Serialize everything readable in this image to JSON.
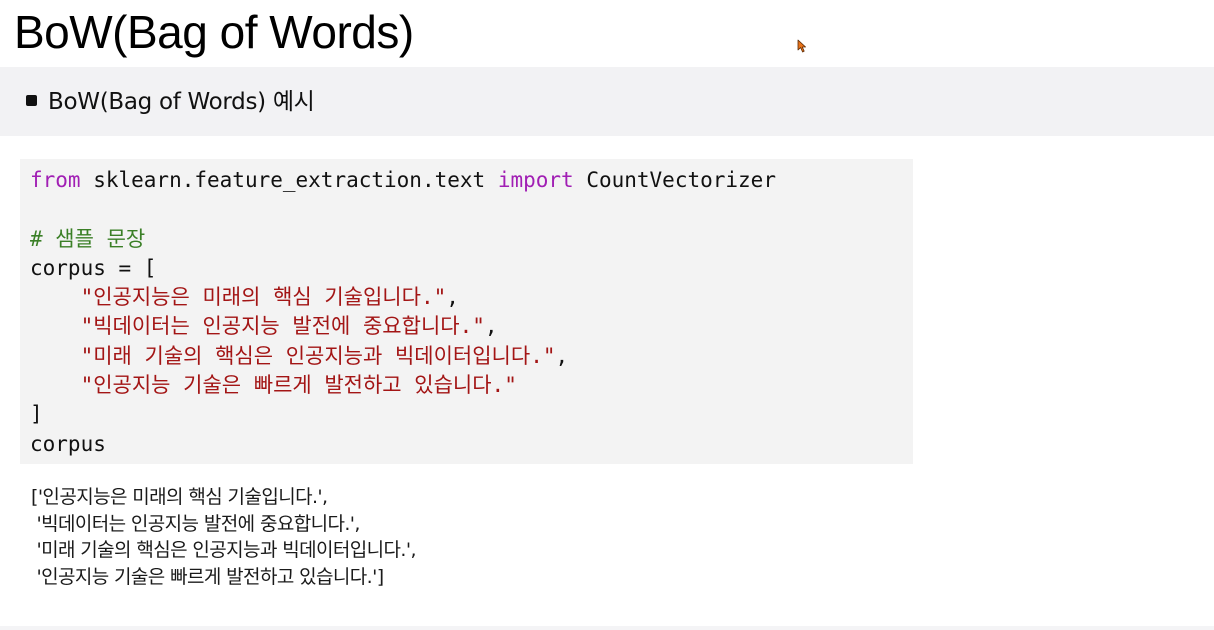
{
  "page": {
    "title": "BoW(Bag of Words)"
  },
  "section": {
    "heading": "BoW(Bag of Words) 예시"
  },
  "code": {
    "kw_from": "from",
    "module": " sklearn.feature_extraction.text ",
    "kw_import": "import",
    "class_name": " CountVectorizer",
    "comment": "# 샘플 문장",
    "corpus_open": "corpus = [",
    "indent": "    ",
    "strings": [
      "\"인공지능은 미래의 핵심 기술입니다.\"",
      "\"빅데이터는 인공지능 발전에 중요합니다.\"",
      "\"미래 기술의 핵심은 인공지능과 빅데이터입니다.\"",
      "\"인공지능 기술은 빠르게 발전하고 있습니다.\""
    ],
    "comma": ",",
    "corpus_close": "]",
    "last_line": "corpus"
  },
  "output": {
    "lines": [
      "['인공지능은 미래의 핵심 기술입니다.',",
      " '빅데이터는 인공지능 발전에 중요합니다.',",
      " '미래 기술의 핵심은 인공지능과 빅데이터입니다.',",
      " '인공지능 기술은 빠르게 발전하고 있습니다.']"
    ]
  },
  "colors": {
    "keyword": "#a11fb4",
    "comment": "#3a7f26",
    "string": "#a31515",
    "code_background": "#f3f3f3",
    "section_background": "#f2f2f4",
    "cursor": "#e8731a"
  },
  "icons": {
    "cursor": "mouse-pointer-icon",
    "bullet": "square-bullet-icon"
  }
}
